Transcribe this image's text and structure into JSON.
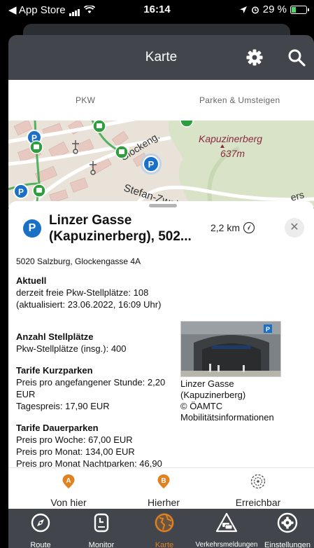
{
  "status_bar": {
    "back_app": "◀ App Store",
    "time": "16:14",
    "battery": "29 %",
    "battery_level": 0.29
  },
  "header": {
    "title": "Karte",
    "settings_icon": "gear-icon",
    "search_icon": "search-icon"
  },
  "tabs": [
    {
      "label": "PKW"
    },
    {
      "label": "Parken & Umsteigen"
    }
  ],
  "map": {
    "labels": {
      "mountain": "Kapuzinerberg",
      "elevation": "637m",
      "street_1": "Glockeng.",
      "street_2": "Stefan-Zwei",
      "street_3": "ers"
    }
  },
  "detail": {
    "icon_letter": "P",
    "title_line1": "Linzer Gasse",
    "title_line2": "(Kapuzinerberg), 502...",
    "distance": "2,2 km",
    "close": "✕",
    "address": "5020 Salzburg, Glockengasse 4A",
    "aktuell": {
      "heading": "Aktuell",
      "line1": "derzeit freie Pkw-Stellplätze: 108",
      "line2": "(aktualisiert: 23.06.2022, 16:09 Uhr)"
    },
    "stellplaetze": {
      "heading": "Anzahl Stellplätze",
      "line1": "Pkw-Stellplätze (insg.): 400"
    },
    "kurzparken": {
      "heading": "Tarife Kurzparken",
      "line1": "Preis pro angefangener Stunde: 2,20",
      "line2": "EUR",
      "line3": "Tagespreis: 17,90 EUR"
    },
    "dauerparken": {
      "heading": "Tarife Dauerparken",
      "line1": "Preis pro Woche: 67,00 EUR",
      "line2": "Preis pro Monat: 134,00 EUR",
      "line3": "Preis pro Monat Nachtparken: 46,90"
    },
    "caption": {
      "line1": "Linzer Gasse",
      "line2": "(Kapuzinerberg)",
      "line3": "© ÖAMTC",
      "line4": "Mobilitätsinformationen"
    }
  },
  "actions": [
    {
      "label": "Von hier",
      "badge": "A"
    },
    {
      "label": "Hierher",
      "badge": "B"
    },
    {
      "label": "Erreichbar"
    }
  ],
  "tabbar": [
    {
      "label": "Route"
    },
    {
      "label": "Monitor"
    },
    {
      "label": "Karte"
    },
    {
      "label": "Verkehrsmeldungen"
    },
    {
      "label": "Einstellungen"
    }
  ],
  "colors": {
    "header_bg": "#42464c",
    "accent": "#e1811f",
    "parking_blue": "#1a6fc6",
    "transit_green": "#2e9e3f",
    "badge_orange": "#e1811f"
  }
}
